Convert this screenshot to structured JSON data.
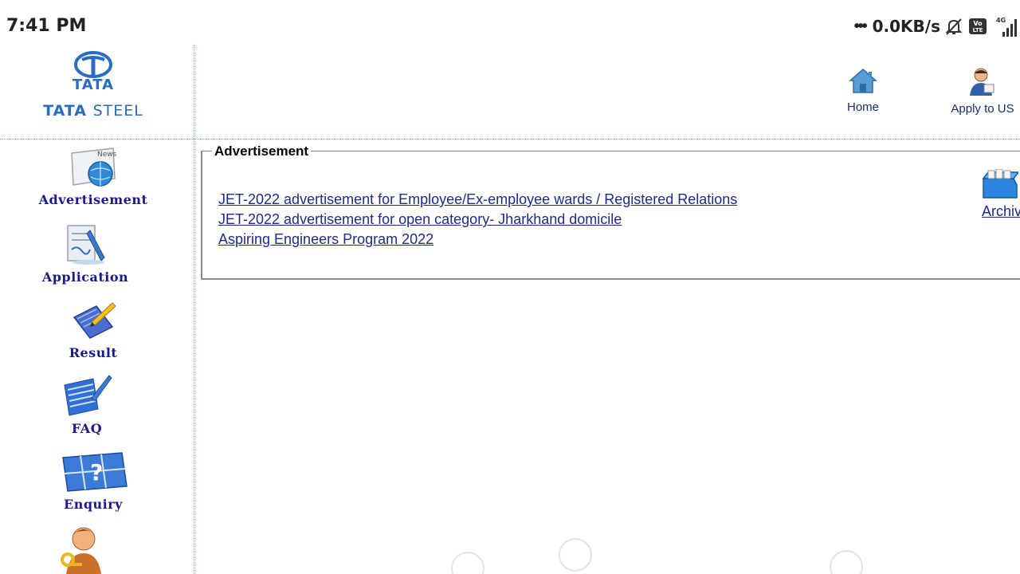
{
  "status_bar": {
    "time": "7:41 PM",
    "dots": "•••",
    "net_speed": "0.0KB/s",
    "network_type": "4G",
    "icons": [
      "mute-icon",
      "volte-icon",
      "signal-icon"
    ]
  },
  "header": {
    "logo_top": "TATA",
    "logo_brand": "TATA",
    "logo_steel": "STEEL",
    "nav": [
      {
        "label": "Home",
        "icon": "home-icon"
      },
      {
        "label": "Apply to US",
        "icon": "user-icon"
      }
    ]
  },
  "sidebar": {
    "items": [
      {
        "label": "Advertisement",
        "icon": "news-globe-icon"
      },
      {
        "label": "Application",
        "icon": "document-pen-icon"
      },
      {
        "label": "Result",
        "icon": "notepad-pencil-icon"
      },
      {
        "label": "FAQ",
        "icon": "lined-paper-pen-icon"
      },
      {
        "label": "Enquiry",
        "icon": "question-board-icon"
      },
      {
        "label": "",
        "icon": "person-key-icon"
      }
    ]
  },
  "main": {
    "section_title": "Advertisement",
    "links": [
      "JET-2022 advertisement for Employee/Ex-employee wards / Registered Relations",
      "JET-2022 advertisement for open category- Jharkhand domicile",
      "Aspiring Engineers Program 2022"
    ],
    "archive_label": "Archive"
  },
  "colors": {
    "brand_blue": "#2a6cc2",
    "menu_text": "#1c1a8a",
    "link": "#1f2a8c",
    "divider": "#5ab5c8"
  }
}
